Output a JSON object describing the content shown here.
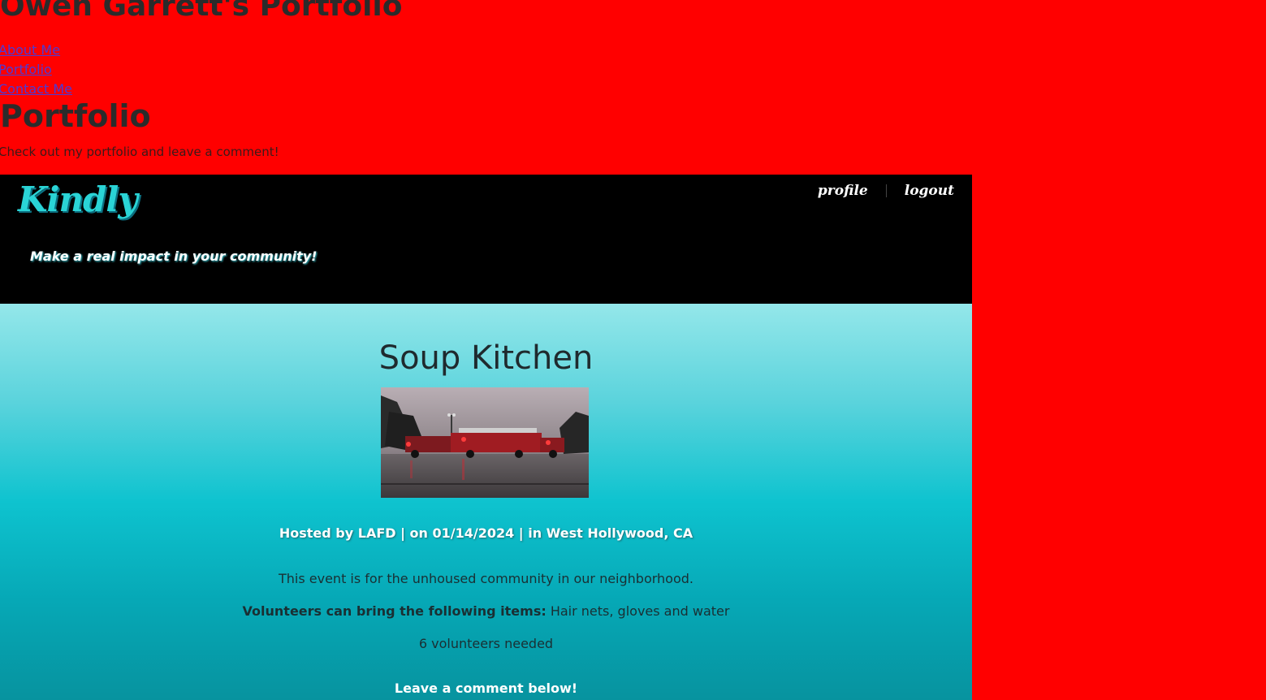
{
  "portfolio": {
    "title": "Owen Garrett's Portfolio",
    "nav": [
      {
        "label": "About Me"
      },
      {
        "label": "Portfolio"
      },
      {
        "label": "Contact Me"
      }
    ],
    "section_title": "Portfolio",
    "section_description": "Check out my portfolio and leave a comment!",
    "background_color": "#ff0000"
  },
  "app": {
    "logo": "Kindly",
    "tagline": "Make a real impact in your community!",
    "nav": {
      "profile": "profile",
      "logout": "logout"
    },
    "accent_color": "#2ad4d6"
  },
  "event": {
    "title": "Soup Kitchen",
    "meta": "Hosted by LAFD | on 01/14/2024 | in West Hollywood, CA",
    "description": "This event is for the unhoused community in our neighborhood.",
    "items_label": "Volunteers can bring the following items:",
    "items_value": " Hair nets, gloves and water",
    "volunteers": "6 volunteers needed",
    "comment_prompt": "Leave a comment below!"
  }
}
